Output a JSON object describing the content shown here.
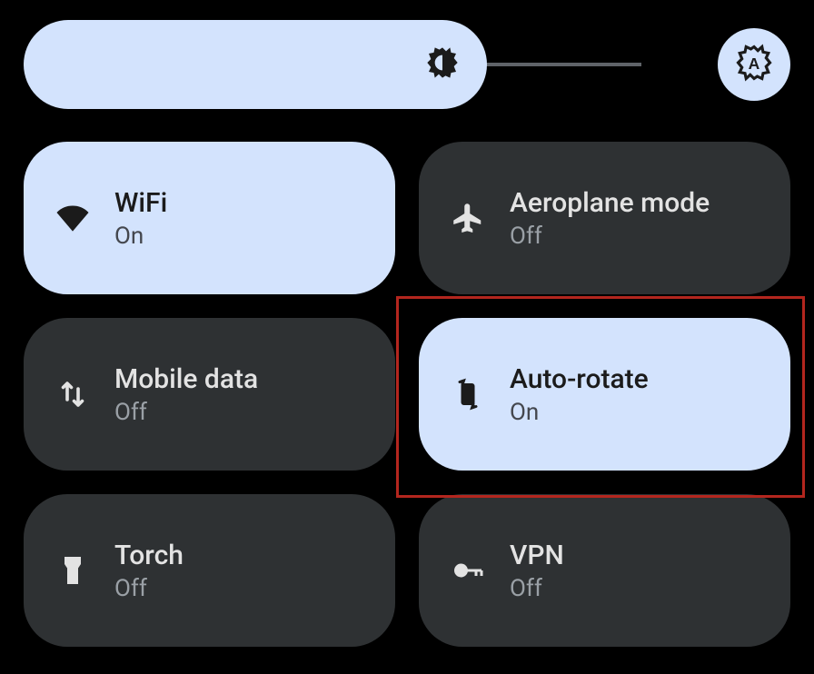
{
  "brightness": {
    "value": 75,
    "icon": "brightness-icon"
  },
  "auto_brightness": {
    "icon": "auto-brightness-icon",
    "on": true
  },
  "tiles": [
    {
      "id": "wifi",
      "label": "WiFi",
      "status": "On",
      "on": true,
      "icon": "wifi-icon"
    },
    {
      "id": "airplane",
      "label": "Aeroplane mode",
      "status": "Off",
      "on": false,
      "icon": "airplane-icon"
    },
    {
      "id": "mobile-data",
      "label": "Mobile data",
      "status": "Off",
      "on": false,
      "icon": "mobile-data-icon"
    },
    {
      "id": "auto-rotate",
      "label": "Auto-rotate",
      "status": "On",
      "on": true,
      "icon": "auto-rotate-icon",
      "highlighted": true
    },
    {
      "id": "torch",
      "label": "Torch",
      "status": "Off",
      "on": false,
      "icon": "torch-icon"
    },
    {
      "id": "vpn",
      "label": "VPN",
      "status": "Off",
      "on": false,
      "icon": "vpn-icon"
    }
  ],
  "colors": {
    "tile_on": "#d3e3fd",
    "tile_off": "#2e3133",
    "highlight": "#b3261e"
  }
}
